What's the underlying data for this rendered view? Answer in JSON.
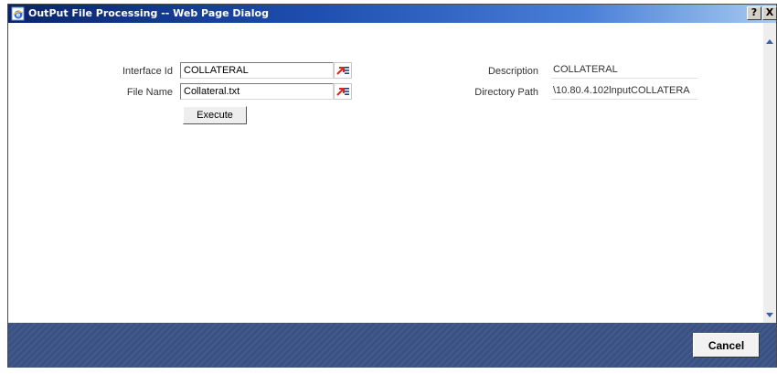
{
  "window": {
    "title": "OutPut File Processing -- Web Page Dialog",
    "help_label": "?",
    "close_label": "X"
  },
  "form": {
    "interface_id": {
      "label": "Interface Id",
      "value": "COLLATERAL"
    },
    "file_name": {
      "label": "File Name",
      "value": "Collateral.txt"
    },
    "description": {
      "label": "Description",
      "value": "COLLATERAL"
    },
    "directory_path": {
      "label": "Directory Path",
      "value": "\\10.80.4.102lnputCOLLATERA"
    },
    "execute_label": "Execute"
  },
  "footer": {
    "cancel_label": "Cancel"
  },
  "colors": {
    "titlebar_start": "#0a246a",
    "footer_bg": "#3a5184"
  }
}
